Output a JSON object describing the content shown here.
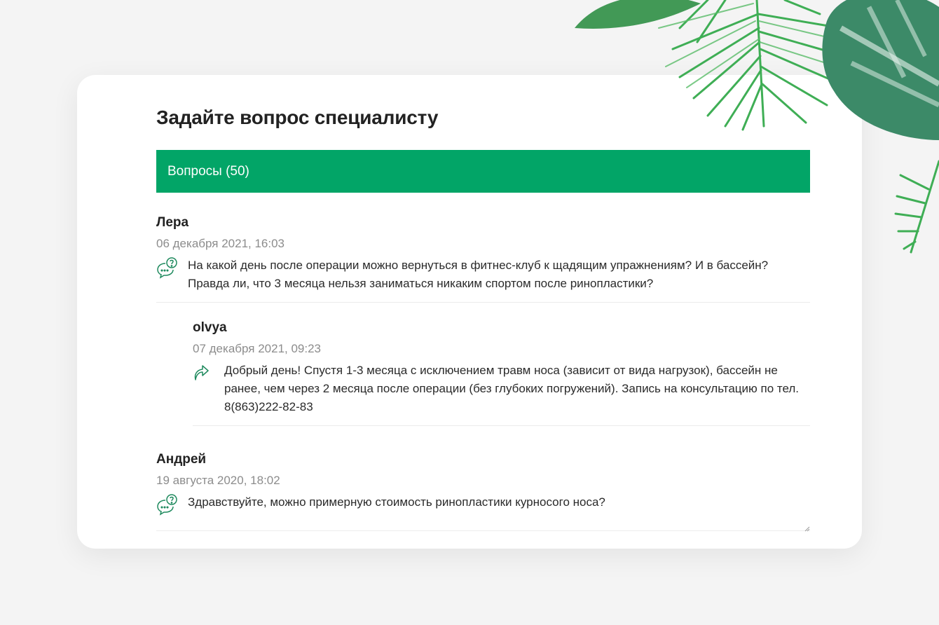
{
  "page": {
    "title": "Задайте вопрос специалисту",
    "tab_label": "Вопросы (50)"
  },
  "threads": [
    {
      "author": "Лера",
      "date": "06 декабря 2021, 16:03",
      "text": "На какой день после операции можно вернуться в фитнес-клуб к щадящим упражнениям? И в бассейн? Правда ли, что 3 месяца нельзя заниматься никаким спортом после ринопластики?",
      "answer": {
        "author": "olvya",
        "date": "07 декабря 2021, 09:23",
        "text": "Добрый день! Спустя 1-3 месяца с исключением травм носа (зависит от вида нагрузок), бассейн не ранее, чем через 2 месяца после операции (без глубоких погружений). Запись на консультацию по тел. 8(863)222-82-83"
      }
    },
    {
      "author": "Андрей",
      "date": "19 августа 2020, 18:02",
      "text": "Здравствуйте, можно примерную стоимость ринопластики курносого носа?"
    }
  ],
  "colors": {
    "accent": "#02a567",
    "icon": "#1f8a5e",
    "background": "#f4f4f4"
  },
  "icons": {
    "question": "question-bubble-icon",
    "answer": "reply-arrow-icon"
  }
}
